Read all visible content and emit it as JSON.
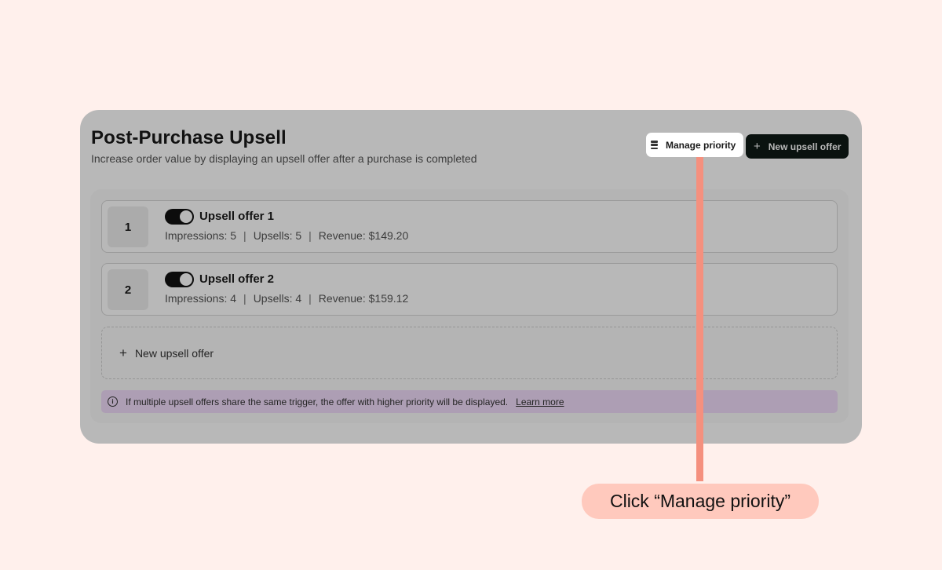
{
  "page": {
    "title": "Post-Purchase Upsell",
    "subtitle": "Increase order value by displaying an upsell offer after a purchase is completed"
  },
  "toolbar": {
    "manage_priority_label": "Manage priority",
    "manage_priority_icon": "list-icon",
    "new_offer_label": "New upsell offer",
    "new_offer_icon": "plus-icon"
  },
  "offers": [
    {
      "rank": "1",
      "name": "Upsell offer 1",
      "enabled": true,
      "impressions": "Impressions: 5",
      "upsells": "Upsells: 5",
      "revenue": "Revenue: $149.20"
    },
    {
      "rank": "2",
      "name": "Upsell offer 2",
      "enabled": true,
      "impressions": "Impressions: 4",
      "upsells": "Upsells: 4",
      "revenue": "Revenue: $159.12"
    }
  ],
  "stats_separator": "|",
  "new_offer_row": {
    "label": "New upsell offer",
    "icon": "plus-icon"
  },
  "info_banner": {
    "icon": "info-icon",
    "text": "If multiple upsell offers share the same trigger, the offer with higher priority will be displayed.",
    "link": "Learn more"
  },
  "hint": {
    "text": "Click “Manage priority”"
  },
  "colors": {
    "page_bg": "#fff0ec",
    "primary_button": "#0f1a16",
    "banner_bg": "#f0dcfa",
    "pointer": "#f5907e",
    "hint_bg": "#ffc9bd"
  }
}
